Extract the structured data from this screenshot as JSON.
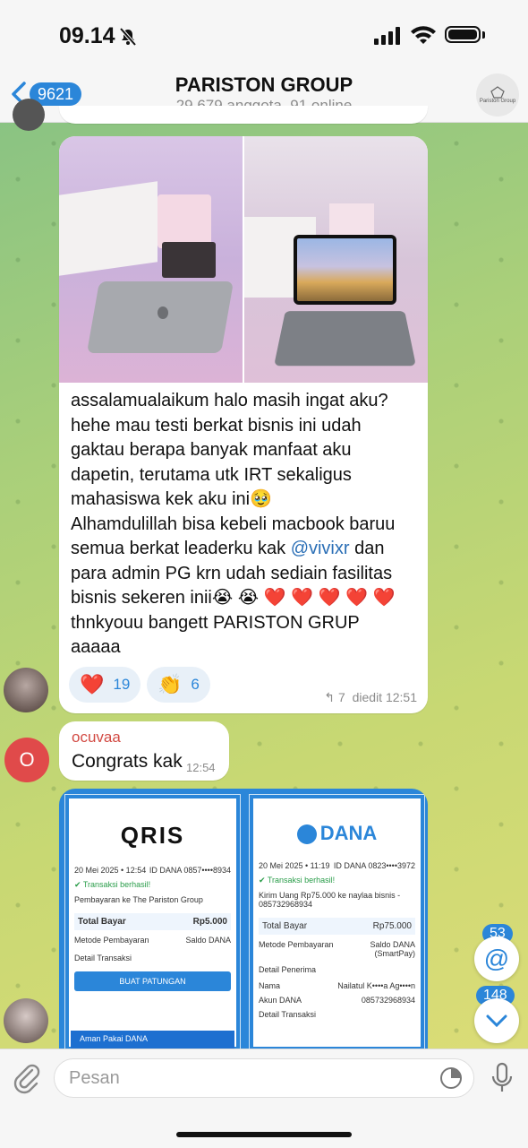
{
  "status": {
    "time": "09.14"
  },
  "header": {
    "back_badge": "9621",
    "title": "PARISTON GROUP",
    "subtitle": "29.679 anggota, 91 online",
    "avatar_text": "Pariston Group"
  },
  "message1": {
    "lines": [
      "assalamualaikum halo masih ingat aku?",
      "hehe mau testi berkat bisnis ini udah",
      "gaktau berapa banyak manfaat aku",
      "dapetin, terutama utk IRT sekaligus",
      "mahasiswa kek aku ini🥹",
      "Alhamdulillah bisa kebeli macbook baruu",
      "semua berkat leaderku kak ",
      "@vivixr",
      " dan",
      "para admin PG krn udah sediain fasilitas",
      "bisnis sekeren inii😭 😭 ❤️ ❤️ ❤️ ❤️ ❤️",
      "thnkyouu bangett PARISTON GRUP",
      "aaaaa"
    ],
    "reactions": [
      {
        "emoji": "❤️",
        "count": "19"
      },
      {
        "emoji": "👏",
        "count": "6"
      }
    ],
    "reply_count": "7",
    "edited_time": "diedit 12:51"
  },
  "message2": {
    "sender": "ocuvaa",
    "avatar_letter": "O",
    "text": "Congrats kak",
    "time": "12:54"
  },
  "message3": {
    "left": {
      "brand": "QRIS",
      "date": "20 Mei 2025 • 12:54",
      "id": "ID DANA 0857••••8934",
      "status": "Transaksi berhasil!",
      "desc": "Pembayaran ke The Pariston Group",
      "total_label": "Total Bayar",
      "total": "Rp5.000",
      "method_label": "Metode Pembayaran",
      "method": "Saldo DANA",
      "detail_label": "Detail Transaksi",
      "button": "BUAT PATUNGAN",
      "promo": "Aman Pakai DANA"
    },
    "right": {
      "brand": "DANA",
      "date": "20 Mei 2025 • 11:19",
      "id": "ID DANA 0823••••3972",
      "status": "Transaksi berhasil!",
      "desc": "Kirim Uang Rp75.000 ke naylaa bisnis - 085732968934",
      "total_label": "Total Bayar",
      "total": "Rp75.000",
      "method_label": "Metode Pembayaran",
      "method": "Saldo DANA (SmartPay)",
      "receiver_label": "Detail Penerima",
      "name_label": "Nama",
      "name": "Nailatul K••••a Ag••••n",
      "account_label": "Akun DANA",
      "account": "085732968934",
      "detail_label": "Detail Transaksi"
    }
  },
  "floating": {
    "mentions": "53",
    "unread": "148"
  },
  "input": {
    "placeholder": "Pesan"
  },
  "colors": {
    "accent": "#2b86d9",
    "sender_name": "#d24a43"
  }
}
